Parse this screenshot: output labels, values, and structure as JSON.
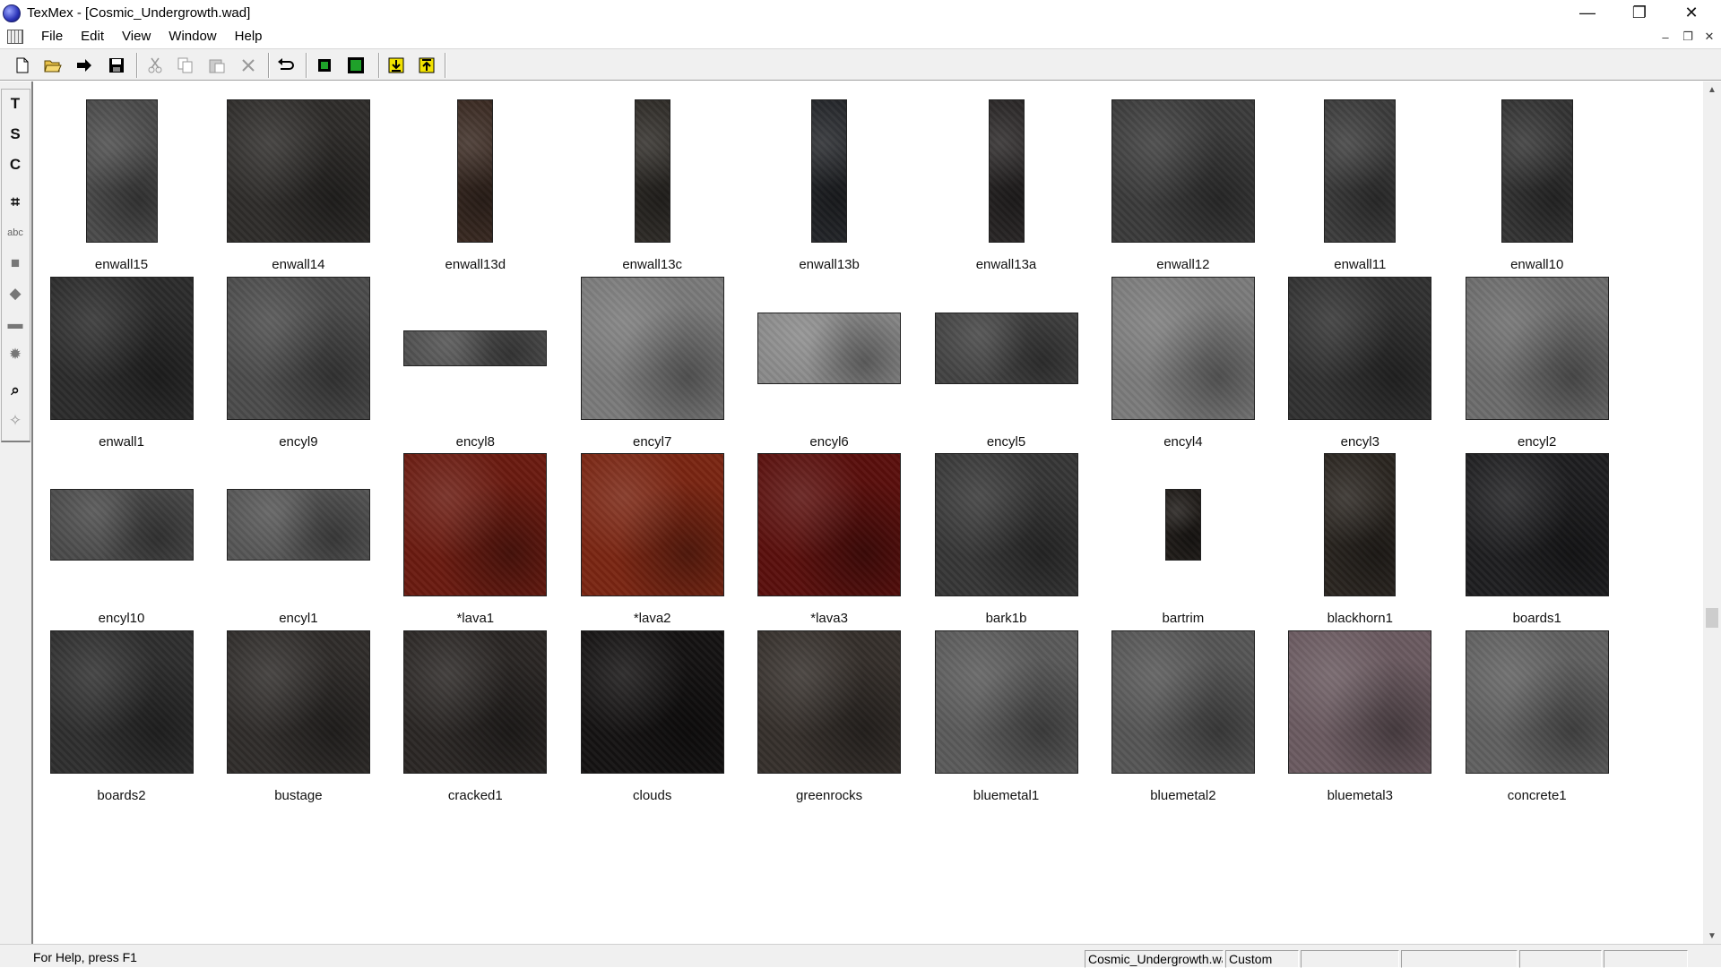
{
  "window": {
    "title": "TexMex - [Cosmic_Undergrowth.wad]",
    "minimize_glyph": "—",
    "restore_glyph": "❐",
    "close_glyph": "✕"
  },
  "menu": {
    "items": [
      "File",
      "Edit",
      "View",
      "Window",
      "Help"
    ],
    "child_min_glyph": "–",
    "child_restore_glyph": "❐",
    "child_close_glyph": "✕"
  },
  "toolbar": {
    "buttons": [
      "new-icon",
      "open-icon",
      "import-icon",
      "save-icon",
      "cut-icon",
      "copy-icon",
      "paste-icon",
      "delete-icon",
      "undo-icon",
      "view-single-icon",
      "view-fit-icon",
      "export-icon",
      "import-texture-icon"
    ]
  },
  "palette": {
    "buttons": [
      {
        "name": "text-tool-icon",
        "glyph": "T"
      },
      {
        "name": "s-tool-icon",
        "glyph": "S"
      },
      {
        "name": "c-tool-icon",
        "glyph": "C"
      },
      {
        "name": "crop-icon",
        "glyph": "⌗"
      },
      {
        "name": "rename-icon",
        "glyph": "abc"
      },
      {
        "name": "fill-icon",
        "glyph": "■"
      },
      {
        "name": "stamp-icon",
        "glyph": "◆"
      },
      {
        "name": "eraser-icon",
        "glyph": "▬"
      },
      {
        "name": "burst-icon",
        "glyph": "✹"
      },
      {
        "name": "zoom-icon",
        "glyph": "⌕"
      },
      {
        "name": "pick-icon",
        "glyph": "✧"
      }
    ]
  },
  "textures": [
    {
      "name": "enwall15",
      "color": "#4a4a4a"
    },
    {
      "name": "enwall14",
      "color": "#2e2c2a"
    },
    {
      "name": "enwall13d",
      "color": "#3a2a22"
    },
    {
      "name": "enwall13c",
      "color": "#2f2c28"
    },
    {
      "name": "enwall13b",
      "color": "#24262a"
    },
    {
      "name": "enwall13a",
      "color": "#2a2727"
    },
    {
      "name": "enwall12",
      "color": "#3a3a3a"
    },
    {
      "name": "enwall11",
      "color": "#3b3b3b"
    },
    {
      "name": "enwall10",
      "color": "#333333"
    },
    {
      "name": "enwall1",
      "color": "#2b2b2b"
    },
    {
      "name": "encyl9",
      "color": "#4b4b4b"
    },
    {
      "name": "encyl8",
      "color": "#4e4e4e"
    },
    {
      "name": "encyl7",
      "color": "#7a7a7a"
    },
    {
      "name": "encyl6",
      "color": "#8a8a8a"
    },
    {
      "name": "encyl5",
      "color": "#424242"
    },
    {
      "name": "encyl4",
      "color": "#7b7b7b"
    },
    {
      "name": "encyl3",
      "color": "#303030"
    },
    {
      "name": "encyl2",
      "color": "#6c6c6c"
    },
    {
      "name": "encyl10",
      "color": "#4a4a4a"
    },
    {
      "name": "encyl1",
      "color": "#555555"
    },
    {
      "name": "*lava1",
      "color": "#6a1a10"
    },
    {
      "name": "*lava2",
      "color": "#7a2512"
    },
    {
      "name": "*lava3",
      "color": "#5a0f0c"
    },
    {
      "name": "bark1b",
      "color": "#363636"
    },
    {
      "name": "bartrim",
      "color": "#1f1b18"
    },
    {
      "name": "blackhorn1",
      "color": "#2a2520"
    },
    {
      "name": "boards1",
      "color": "#1e1e20"
    },
    {
      "name": "boards2",
      "color": "#2e2e2e"
    },
    {
      "name": "bustage",
      "color": "#2f2c2a"
    },
    {
      "name": "cracked1",
      "color": "#2a2624"
    },
    {
      "name": "clouds",
      "color": "#141212"
    },
    {
      "name": "greenrocks",
      "color": "#352f2b"
    },
    {
      "name": "bluemetal1",
      "color": "#5a5a5a"
    },
    {
      "name": "bluemetal2",
      "color": "#555555"
    },
    {
      "name": "bluemetal3",
      "color": "#6a5a60"
    },
    {
      "name": "concrete1",
      "color": "#606060"
    }
  ],
  "status": {
    "help": "For Help, press F1",
    "file": "Cosmic_Undergrowth.wad",
    "mode": "Custom"
  }
}
